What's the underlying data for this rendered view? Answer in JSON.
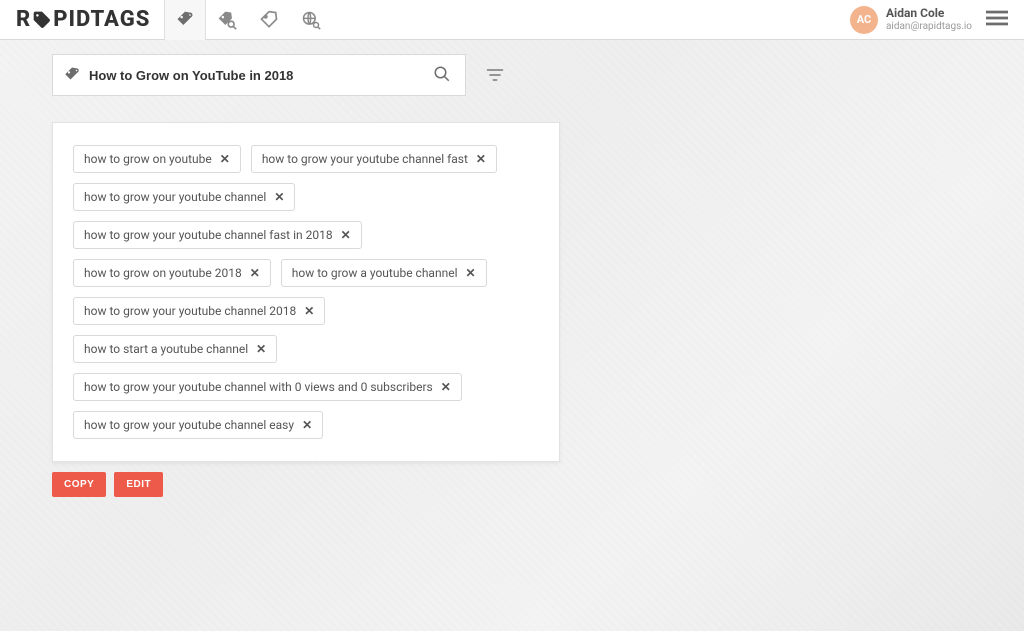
{
  "brand": {
    "prefix": "R",
    "suffix": "PIDTAGS"
  },
  "user": {
    "initials": "AC",
    "name": "Aidan Cole",
    "email": "aidan@rapidtags.io"
  },
  "search": {
    "value": "How to Grow on YouTube in 2018"
  },
  "tags": [
    "how to grow on youtube",
    "how to grow your youtube channel fast",
    "how to grow your youtube channel",
    "how to grow your youtube channel fast in 2018",
    "how to grow on youtube 2018",
    "how to grow a youtube channel",
    "how to grow your youtube channel 2018",
    "how to start a youtube channel",
    "how to grow your youtube channel with 0 views and 0 subscribers",
    "how to grow your youtube channel easy"
  ],
  "buttons": {
    "copy": "COPY",
    "edit": "EDIT"
  }
}
